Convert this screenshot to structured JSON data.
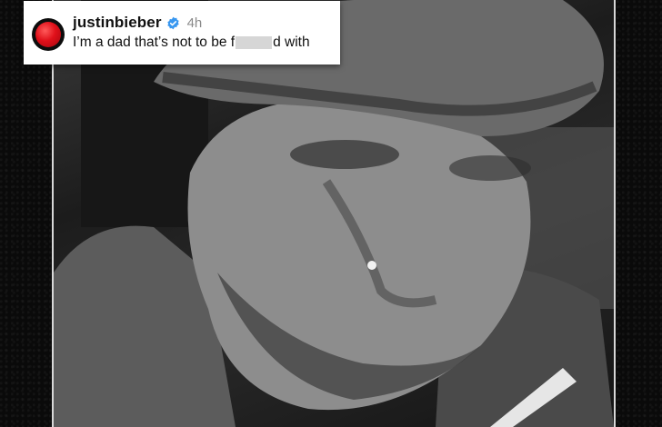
{
  "post": {
    "username": "justinbieber",
    "timestamp": "4h",
    "caption_before": "I’m a dad that’s not to be f",
    "caption_after": "d with",
    "verified": true
  },
  "colors": {
    "verified_badge": "#3897f0",
    "avatar_red": "#e0101a",
    "background": "#0b0b0b"
  },
  "icons": {
    "verified": "verified-badge-icon",
    "avatar": "profile-avatar"
  }
}
